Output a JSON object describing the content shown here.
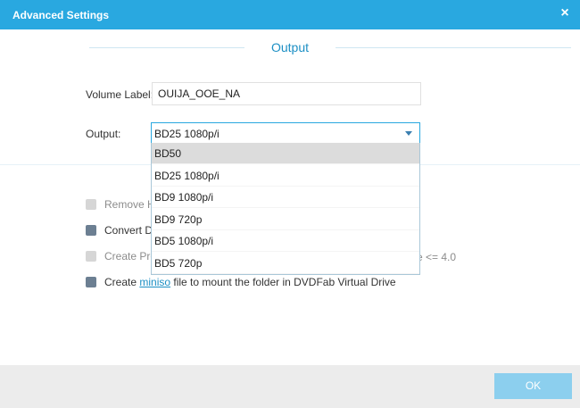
{
  "window": {
    "title": "Advanced Settings",
    "close_glyph": "×"
  },
  "section": {
    "title": "Output"
  },
  "volume_label": {
    "label": "Volume Label:",
    "value": "OUIJA_OOE_NA"
  },
  "output": {
    "label": "Output:",
    "selected": "BD25 1080p/i",
    "options": [
      "BD50",
      "BD25 1080p/i",
      "BD9 1080p/i",
      "BD9 720p",
      "BD5 1080p/i",
      "BD5 720p"
    ],
    "highlighted": "BD50"
  },
  "options": {
    "remove_hd": {
      "text": "Remove HI",
      "checked": false,
      "disabled": true
    },
    "convert_dts": {
      "text": "Convert DT",
      "checked": true,
      "disabled": false
    },
    "create_profile": {
      "text": "Create Pro",
      "trail": "e <= 4.0",
      "checked": false,
      "disabled": true
    },
    "create_miniso": {
      "text_before": "Create ",
      "link": "miniso",
      "text_after": " file to mount the folder in DVDFab Virtual Drive",
      "checked": true,
      "disabled": false
    }
  },
  "footer": {
    "ok_label": "OK"
  },
  "colors": {
    "accent": "#29a8e0",
    "ok_button": "#8ccfee",
    "checkbox_checked": "#6c7f92"
  },
  "icons": {
    "close": "close-icon",
    "dropdown": "chevron-down-icon"
  }
}
